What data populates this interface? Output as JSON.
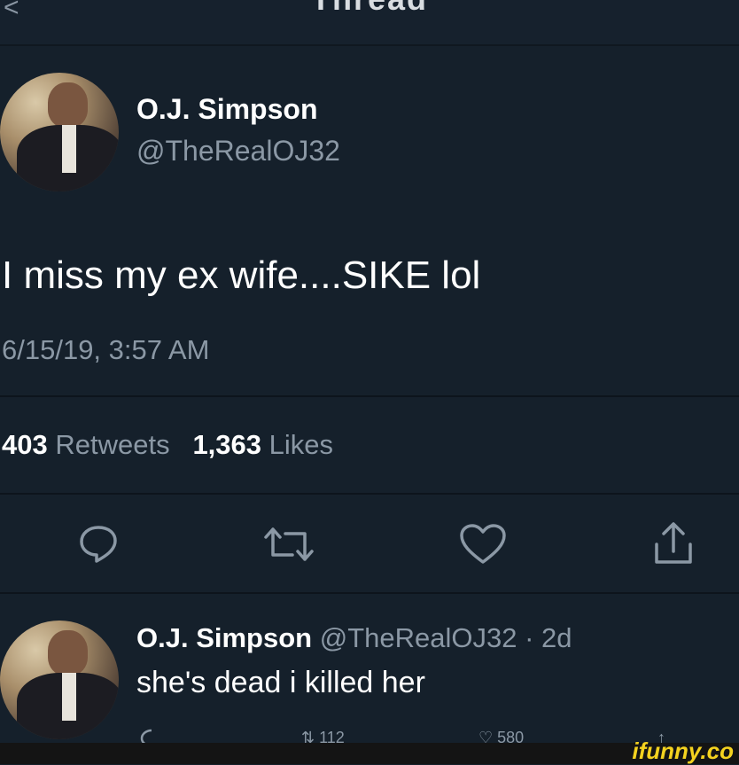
{
  "header": {
    "title": "Thread",
    "back_glyph": "<"
  },
  "tweet": {
    "author_name": "O.J. Simpson",
    "author_handle": "@TheRealOJ32",
    "text": "I miss my ex wife....SIKE lol",
    "timestamp": "6/15/19, 3:57 AM",
    "retweets_count": "403",
    "retweets_label": "Retweets",
    "likes_count": "1,363",
    "likes_label": "Likes"
  },
  "actions": {
    "reply_icon": "reply-icon",
    "retweet_icon": "retweet-icon",
    "like_icon": "heart-icon",
    "share_icon": "share-icon"
  },
  "reply": {
    "author_name": "O.J. Simpson",
    "meta": "@TheRealOJ32 · 2d",
    "text": "she's dead i killed her",
    "retweets_count": "112",
    "likes_count": "580"
  },
  "watermark": "ifunny.co",
  "colors": {
    "background": "#15202b",
    "secondary_text": "#8b98a5",
    "watermark": "#f4d21f"
  }
}
